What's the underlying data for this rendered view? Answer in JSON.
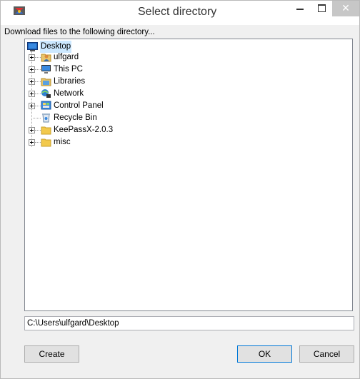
{
  "window": {
    "title": "Select directory",
    "close_glyph": "✕"
  },
  "instruction": "Download files to the following directory...",
  "tree": {
    "root": {
      "label": "Desktop",
      "icon": "desktop-icon"
    },
    "items": [
      {
        "label": "ulfgard",
        "icon": "user-folder-icon",
        "expandable": true
      },
      {
        "label": "This PC",
        "icon": "computer-icon",
        "expandable": true
      },
      {
        "label": "Libraries",
        "icon": "libraries-icon",
        "expandable": true
      },
      {
        "label": "Network",
        "icon": "network-icon",
        "expandable": true
      },
      {
        "label": "Control Panel",
        "icon": "control-panel-icon",
        "expandable": true
      },
      {
        "label": "Recycle Bin",
        "icon": "recycle-bin-icon",
        "expandable": false
      },
      {
        "label": "KeePassX-2.0.3",
        "icon": "folder-icon",
        "expandable": true
      },
      {
        "label": "misc",
        "icon": "folder-icon",
        "expandable": true
      }
    ]
  },
  "path_field": {
    "value": "C:\\Users\\ulfgard\\Desktop"
  },
  "buttons": {
    "create": "Create",
    "ok": "OK",
    "cancel": "Cancel"
  },
  "colors": {
    "selection": "#cce8ff",
    "accent": "#0078d7",
    "close_button": "#c7c7c7"
  }
}
